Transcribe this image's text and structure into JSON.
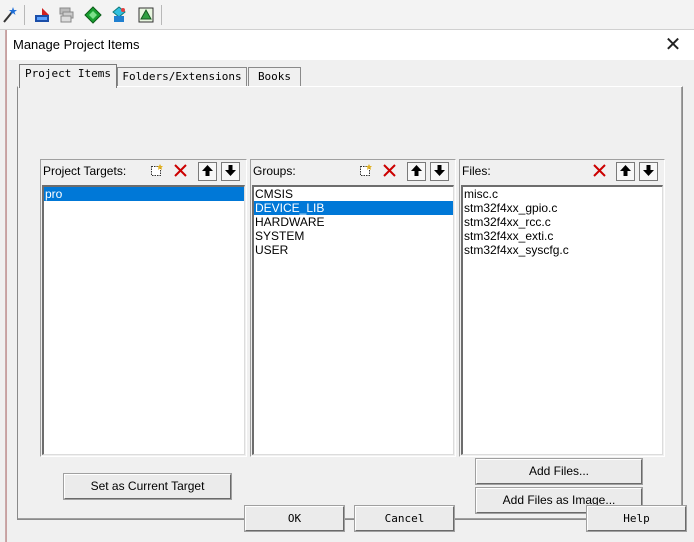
{
  "toolbar": {
    "icons": [
      "magic-wand-icon",
      "translate-icon",
      "build-icon",
      "diamond-icon",
      "options-icon",
      "batch-icon"
    ]
  },
  "dialog": {
    "title": "Manage Project Items",
    "close_glyph": "✕"
  },
  "tabs": [
    {
      "label": "Project Items",
      "active": true
    },
    {
      "label": "Folders/Extensions",
      "active": false
    },
    {
      "label": "Books",
      "active": false
    }
  ],
  "panels": {
    "targets": {
      "label": "Project Targets:",
      "items": [
        "pro"
      ],
      "selected": 0
    },
    "groups": {
      "label": "Groups:",
      "items": [
        "CMSIS",
        "DEVICE_LIB",
        "HARDWARE",
        "SYSTEM",
        "USER"
      ],
      "selected": 1
    },
    "files": {
      "label": "Files:",
      "items": [
        "misc.c",
        "stm32f4xx_gpio.c",
        "stm32f4xx_rcc.c",
        "stm32f4xx_exti.c",
        "stm32f4xx_syscfg.c"
      ],
      "selected": -1
    }
  },
  "buttons": {
    "set_target": "Set as Current Target",
    "add_files": "Add Files...",
    "add_files_image": "Add Files as Image...",
    "ok": "OK",
    "cancel": "Cancel",
    "help": "Help"
  },
  "colors": {
    "selection": "#0078d7",
    "delete_red": "#cc0000"
  }
}
